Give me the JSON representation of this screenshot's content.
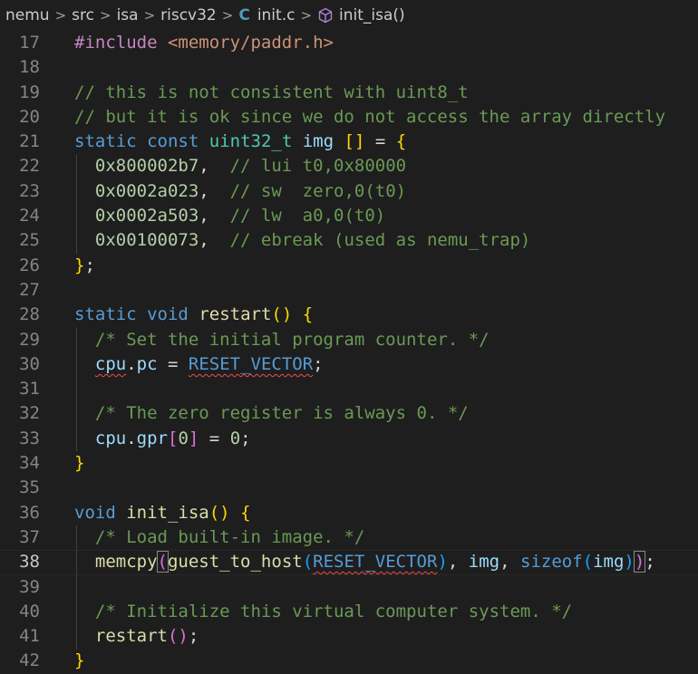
{
  "breadcrumb": {
    "items": [
      "nemu",
      "src",
      "isa",
      "riscv32",
      "init.c",
      "init_isa()"
    ],
    "separator": ">",
    "file_icon": "C"
  },
  "editor": {
    "current_line": 38,
    "lines": [
      {
        "n": 17,
        "html": "<span class=\"pp\">#include</span> <span class=\"str\">&lt;memory/paddr.h&gt;</span>"
      },
      {
        "n": 18,
        "html": ""
      },
      {
        "n": 19,
        "html": "<span class=\"cm\">// this is not consistent with uint8_t</span>"
      },
      {
        "n": 20,
        "html": "<span class=\"cm\">// but it is ok since we do not access the array directly</span>"
      },
      {
        "n": 21,
        "html": "<span class=\"kw\">static</span> <span class=\"kw\">const</span> <span class=\"ty\">uint32_t</span> <span class=\"var\">img</span> <span class=\"b1\">[]</span> = <span class=\"b1\">{</span>"
      },
      {
        "n": 22,
        "html": "  <span class=\"num\">0x800002b7</span>,  <span class=\"cm\">// lui t0,0x80000</span>"
      },
      {
        "n": 23,
        "html": "  <span class=\"num\">0x0002a023</span>,  <span class=\"cm\">// sw  zero,0(t0)</span>"
      },
      {
        "n": 24,
        "html": "  <span class=\"num\">0x0002a503</span>,  <span class=\"cm\">// lw  a0,0(t0)</span>"
      },
      {
        "n": 25,
        "html": "  <span class=\"num\">0x00100073</span>,  <span class=\"cm\">// ebreak (used as nemu_trap)</span>"
      },
      {
        "n": 26,
        "html": "<span class=\"b1\">}</span>;"
      },
      {
        "n": 27,
        "html": ""
      },
      {
        "n": 28,
        "html": "<span class=\"kw\">static</span> <span class=\"kw\">void</span> <span class=\"fn\">restart</span><span class=\"b1\">()</span> <span class=\"b1\">{</span>"
      },
      {
        "n": 29,
        "html": "  <span class=\"cm\">/* Set the initial program counter. */</span>"
      },
      {
        "n": 30,
        "html": "  <span class=\"var squig\">cpu</span>.<span class=\"var\">pc</span> = <span class=\"mac squig\">RESET_VECTOR</span>;"
      },
      {
        "n": 31,
        "html": ""
      },
      {
        "n": 32,
        "html": "  <span class=\"cm\">/* The zero register is always 0. */</span>"
      },
      {
        "n": 33,
        "html": "  <span class=\"var\">cpu</span>.<span class=\"var\">gpr</span><span class=\"b2\">[</span><span class=\"num\">0</span><span class=\"b2\">]</span> = <span class=\"num\">0</span>;"
      },
      {
        "n": 34,
        "html": "<span class=\"b1\">}</span>"
      },
      {
        "n": 35,
        "html": ""
      },
      {
        "n": 36,
        "html": "<span class=\"kw\">void</span> <span class=\"fn\">init_isa</span><span class=\"b1\">()</span> <span class=\"b1\">{</span>"
      },
      {
        "n": 37,
        "html": "  <span class=\"cm\">/* Load built-in image. */</span>"
      },
      {
        "n": 38,
        "html": "  <span class=\"fn\">memcpy</span><span class=\"b2 cursor-box\">(</span><span class=\"fn\">guest_to_host</span><span class=\"b3\">(</span><span class=\"mac squig\">RESET_VECTOR</span><span class=\"b3\">)</span>, <span class=\"var\">img</span>, <span class=\"kw\">sizeof</span><span class=\"b3\">(</span><span class=\"var\">img</span><span class=\"b3\">)</span><span class=\"b2 cursor-box\">)</span>;"
      },
      {
        "n": 39,
        "html": ""
      },
      {
        "n": 40,
        "html": "  <span class=\"cm\">/* Initialize this virtual computer system. */</span>"
      },
      {
        "n": 41,
        "html": "  <span class=\"fn\">restart</span><span class=\"b2\">()</span>;"
      },
      {
        "n": 42,
        "html": "<span class=\"b1\">}</span>"
      }
    ]
  }
}
